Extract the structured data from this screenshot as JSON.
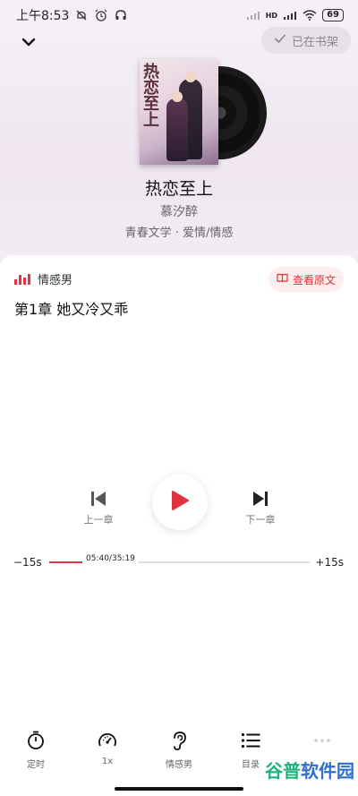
{
  "status_bar": {
    "time": "上午8:53",
    "network": "HD",
    "battery": "69"
  },
  "header": {
    "shelf_label": "已在书架"
  },
  "book": {
    "title": "热恋至上",
    "author": "慕汐醉",
    "tags": "青春文学 · 爱情/情感",
    "cover_art_text": "热恋至上"
  },
  "narrator": {
    "name": "情感男",
    "view_original_label": "查看原文"
  },
  "chapter": {
    "title": "第1章 她又冷又乖"
  },
  "controls": {
    "prev_label": "上一章",
    "next_label": "下一章"
  },
  "progress": {
    "skip_back": "−15s",
    "skip_forward": "+15s",
    "time_display": "05:40/35:19",
    "fraction": 0.161
  },
  "bottom_nav": {
    "items": [
      {
        "label": "定时",
        "icon": "timer-icon"
      },
      {
        "label": "1x",
        "icon": "speed-icon"
      },
      {
        "label": "情感男",
        "icon": "ear-icon"
      },
      {
        "label": "目录",
        "icon": "list-icon"
      },
      {
        "label": "",
        "icon": "more-icon"
      }
    ]
  },
  "watermark": {
    "part1": "谷普",
    "part2": "软件园"
  },
  "colors": {
    "accent": "#e0323f",
    "background_top": "#f3eef3"
  }
}
